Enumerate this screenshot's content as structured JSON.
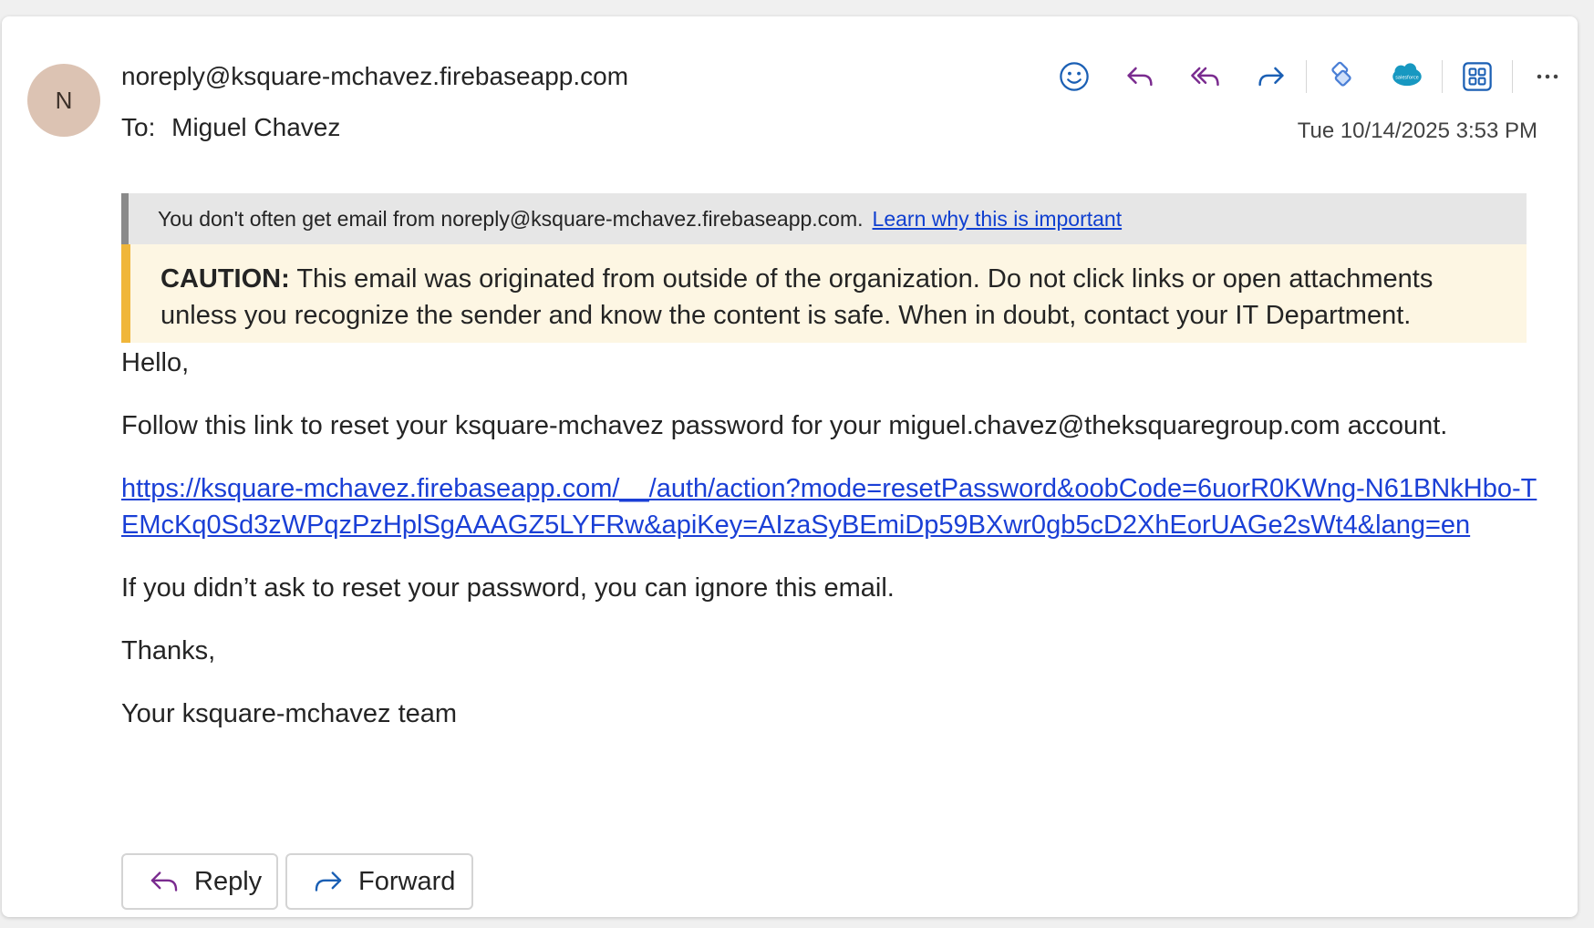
{
  "sender": {
    "initial": "N",
    "email": "noreply@ksquare-mchavez.firebaseapp.com",
    "to_label": "To:",
    "to_name": "Miguel Chavez",
    "timestamp": "Tue 10/14/2025 3:53 PM"
  },
  "toolbar": {
    "icons": [
      "emoji-icon",
      "reply-icon",
      "reply-all-icon",
      "forward-icon",
      "diamond-addin-icon",
      "salesforce-icon",
      "apps-icon",
      "more-icon"
    ],
    "salesforce_text": "salesforce",
    "more_label": "···"
  },
  "banners": {
    "external_text": "You don't often get email from noreply@ksquare-mchavez.firebaseapp.com.",
    "external_link": "Learn why this is important",
    "caution_label": "CAUTION:",
    "caution_text": "This email was originated from outside of the organization. Do not click links or open attachments unless you recognize the sender and know the content is safe. When in doubt, contact your IT Department."
  },
  "body": {
    "greeting": "Hello,",
    "instruction": "Follow this link to reset your ksquare-mchavez password for your miguel.chavez@theksquaregroup.com account.",
    "link": "https://ksquare-mchavez.firebaseapp.com/__/auth/action?mode=resetPassword&oobCode=6uorR0KWng-N61BNkHbo-TEMcKq0Sd3zWPqzPzHplSgAAAGZ5LYFRw&apiKey=AIzaSyBEmiDp59BXwr0gb5cD2XhEorUAGe2sWt4&lang=en",
    "ignore_note": "If you didn’t ask to reset your password, you can ignore this email.",
    "thanks": "Thanks,",
    "signature": "Your ksquare-mchavez team"
  },
  "buttons": {
    "reply_label": "Reply",
    "forward_label": "Forward"
  },
  "colors": {
    "accent_blue": "#1a3fd6",
    "reply_purple": "#7a2b8f",
    "avatar_bg": "#dcc3b3",
    "caution_bar": "#f0b63a",
    "caution_bg": "#fdf6e3"
  }
}
